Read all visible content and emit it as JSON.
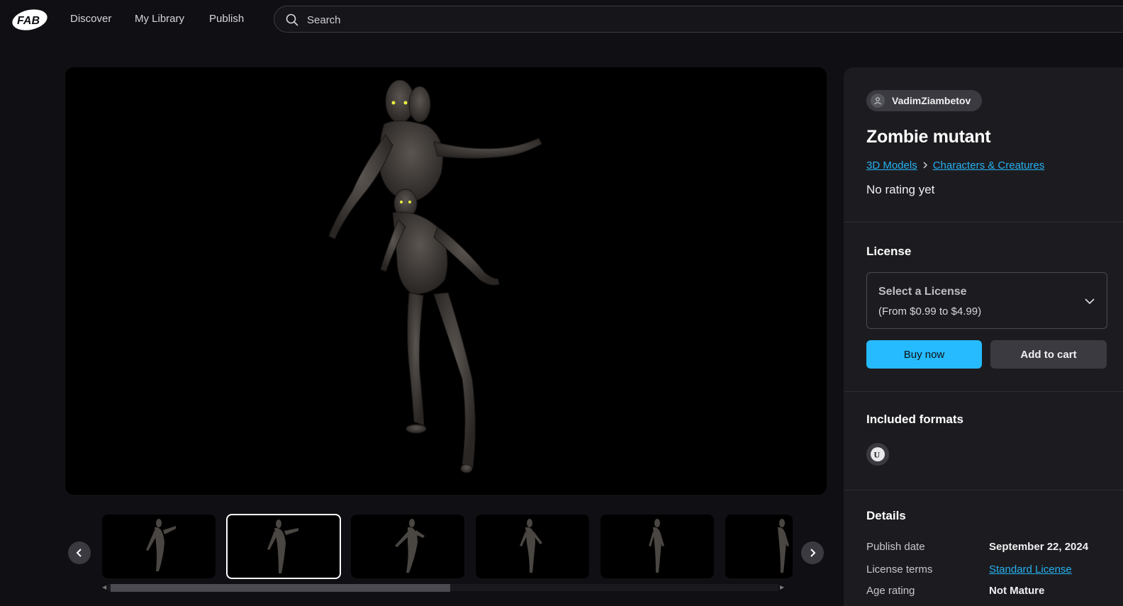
{
  "nav": {
    "logo_alt": "FAB",
    "links": [
      "Discover",
      "My Library",
      "Publish"
    ],
    "search_placeholder": "Search"
  },
  "viewer": {
    "thumbnail_count": 6,
    "active_thumbnail_index": 1
  },
  "product": {
    "seller": "VadimZiambetov",
    "title": "Zombie mutant",
    "breadcrumb": [
      "3D Models",
      "Characters & Creatures"
    ],
    "rating_text": "No rating yet"
  },
  "license": {
    "heading": "License",
    "select_title": "Select a License",
    "select_price_range": "(From $0.99 to $4.99)",
    "buy_now_label": "Buy now",
    "add_to_cart_label": "Add to cart"
  },
  "formats": {
    "heading": "Included formats",
    "icons": [
      "unreal-engine-icon"
    ]
  },
  "details": {
    "heading": "Details",
    "rows": [
      {
        "label": "Publish date",
        "value": "September 22, 2024"
      },
      {
        "label": "License terms",
        "value": "Standard License"
      },
      {
        "label": "Age rating",
        "value": "Not Mature"
      }
    ]
  },
  "colors": {
    "background": "#101014",
    "panel": "#1c1c20",
    "accent": "#26bbff",
    "link": "#27b0f0"
  }
}
